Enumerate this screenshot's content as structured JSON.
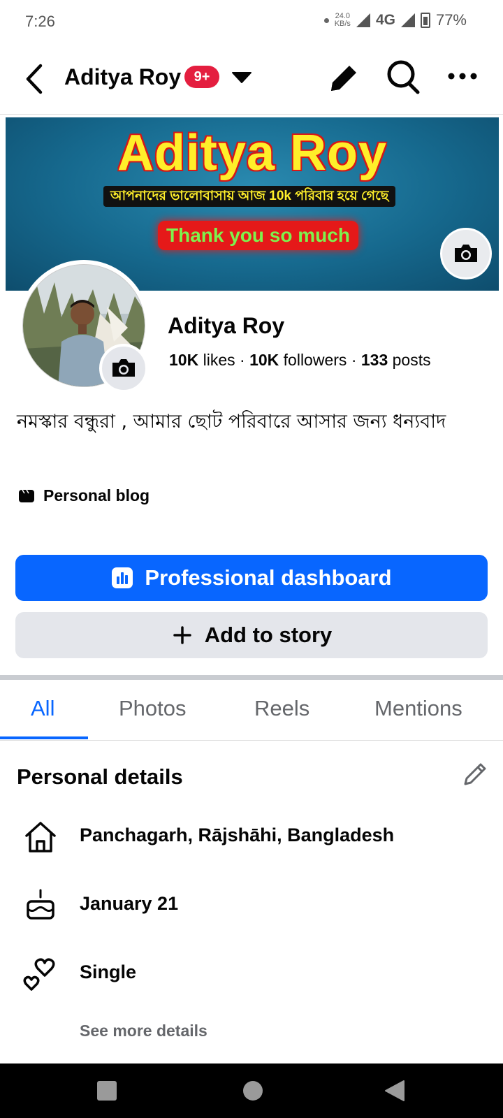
{
  "status_bar": {
    "time": "7:26",
    "speed_value": "24.0",
    "speed_unit": "KB/s",
    "network": "4G",
    "battery": "77%"
  },
  "header": {
    "title": "Aditya Roy",
    "badge": "9+"
  },
  "cover": {
    "title": "Aditya Roy",
    "subtitle": "আপনাদের ভালোবাসায় আজ 10k পরিবার হয়ে গেছে",
    "thanks": "Thank you so much"
  },
  "profile": {
    "name": "Aditya Roy",
    "likes_value": "10K",
    "likes_label": "likes",
    "followers_value": "10K",
    "followers_label": "followers",
    "posts_value": "133",
    "posts_label": "posts",
    "bio": "নমস্কার বন্ধুরা , আমার ছোট পরিবারে আসার জন্য ধন্যবাদ",
    "category": "Personal blog"
  },
  "buttons": {
    "dashboard": "Professional dashboard",
    "add_story": "Add to story"
  },
  "tabs": [
    {
      "label": "All",
      "active": true
    },
    {
      "label": "Photos",
      "active": false
    },
    {
      "label": "Reels",
      "active": false
    },
    {
      "label": "Mentions",
      "active": false
    }
  ],
  "details": {
    "title": "Personal details",
    "items": [
      {
        "icon": "home-icon",
        "text": "Panchagarh, Rājshāhi, Bangladesh"
      },
      {
        "icon": "birthday-cake-icon",
        "text": "January 21"
      },
      {
        "icon": "hearts-icon",
        "text": "Single"
      }
    ],
    "see_more": "See more details"
  },
  "colors": {
    "accent": "#0866ff",
    "badge": "#e41e3f",
    "secondary_button": "#e4e6eb",
    "muted_text": "#65676b"
  }
}
